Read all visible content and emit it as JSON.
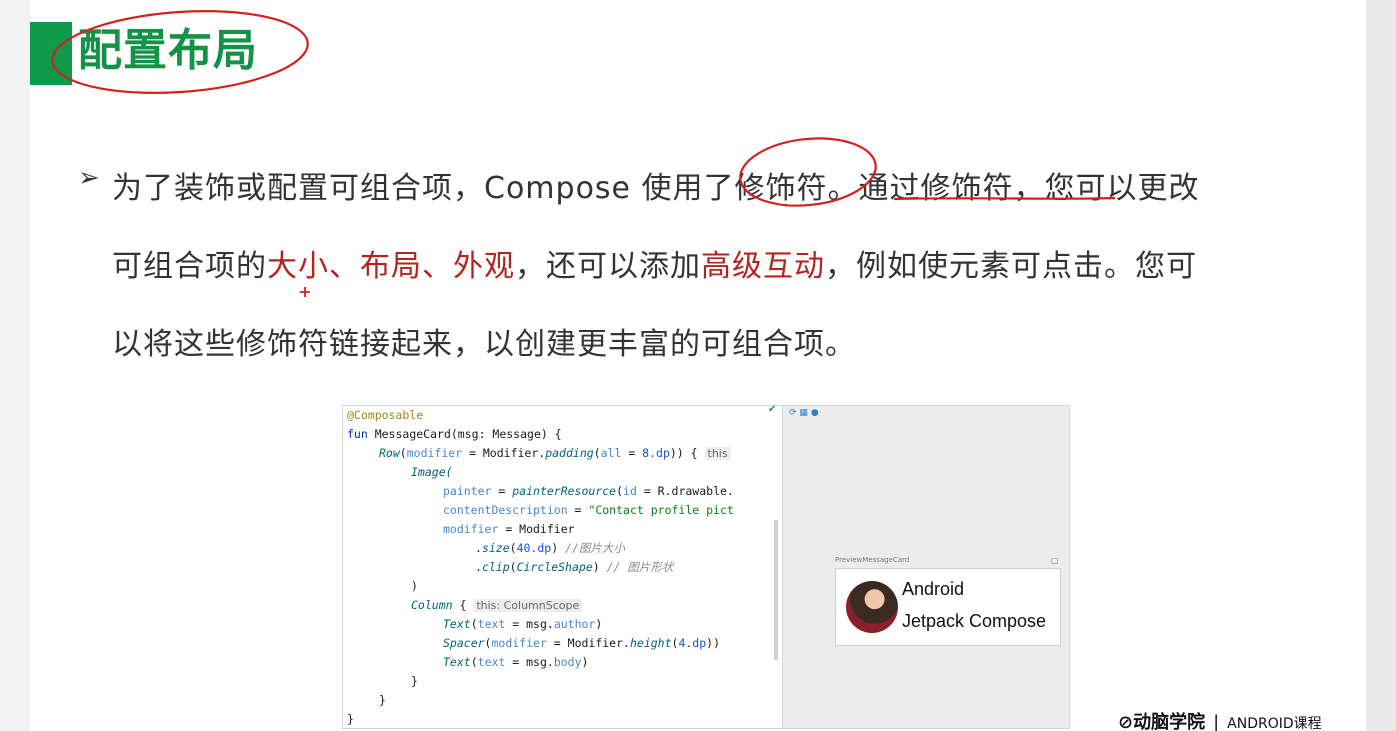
{
  "slide": {
    "title": "配置布局",
    "bullet_symbol": "➢",
    "line1_a": "为了装饰或配置可组合项，Compose 使用了",
    "line1_b": "修饰符",
    "line1_c": "。",
    "line1_d": "通过修饰符，您可以更改",
    "line2_a": "可组合项的",
    "line2_red1": "大小、布局、外观",
    "line2_b": "，还可以添加",
    "line2_red2": "高级互动",
    "line2_c": "，例如使元素可点击。您可",
    "line3": "以将这些修饰符链接起来，以创建更丰富的可组合项。",
    "accent_color": "#149245",
    "highlight_color": "#b0261e"
  },
  "code": {
    "l1": "@Composable",
    "l2_kw": "fun ",
    "l2_fn": "MessageCard",
    "l2_rest": "(msg: Message) {",
    "l3_fn": "Row",
    "l3_a": "(",
    "l3_pm": "modifier",
    "l3_b": " = Modifier.",
    "l3_fn2": "padding",
    "l3_c": "(",
    "l3_pm2": "all",
    "l3_d": " = ",
    "l3_num": "8.dp",
    "l3_e": ")) { ",
    "l3_hint": "this",
    "l4": "Image(",
    "l5_pm": "painter",
    "l5_b": " = ",
    "l5_fn": "painterResource",
    "l5_c": "(",
    "l5_pm2": "id",
    "l5_d": " = R.drawable.",
    "l6_pm": "contentDescription",
    "l6_b": " = ",
    "l6_str": "\"Contact profile pict",
    "l7_pm": "modifier",
    "l7_b": " = Modifier",
    "l8_a": ".",
    "l8_fn": "size",
    "l8_b": "(",
    "l8_num": "40.dp",
    "l8_c": ") ",
    "l8_cm": "//图片大小",
    "l9_a": ".",
    "l9_fn": "clip",
    "l9_b": "(",
    "l9_fn2": "CircleShape",
    "l9_c": ") ",
    "l9_cm": "// 图片形状",
    "l10": ")",
    "l11_fn": "Column",
    "l11_b": " { ",
    "l11_hint": "this: ColumnScope",
    "l12_fn": "Text",
    "l12_a": "(",
    "l12_pm": "text",
    "l12_b": " = msg.",
    "l12_c": "author",
    "l12_d": ")",
    "l13_fn": "Spacer",
    "l13_a": "(",
    "l13_pm": "modifier",
    "l13_b": " = Modifier.",
    "l13_fn2": "height",
    "l13_c": "(",
    "l13_num": "4.dp",
    "l13_d": "))",
    "l14_fn": "Text",
    "l14_a": "(",
    "l14_pm": "text",
    "l14_b": " = msg.",
    "l14_c": "body",
    "l14_d": ")",
    "l15": "}",
    "l16": "}",
    "l17": "}"
  },
  "preview": {
    "label": "PreviewMessageCard",
    "author": "Android",
    "body": "Jetpack Compose"
  },
  "logo": {
    "brand": "动脑学院",
    "separator": "|",
    "course": "ANDROID课程"
  }
}
